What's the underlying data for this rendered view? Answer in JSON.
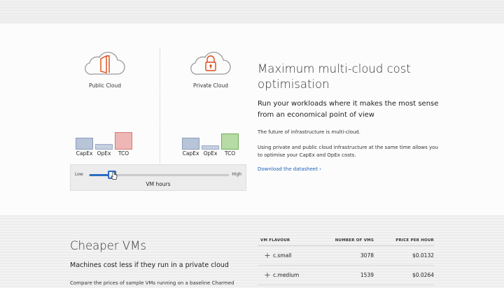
{
  "public_cloud": {
    "label": "Public Cloud",
    "bars": [
      {
        "label": "CapEx",
        "value": 0.62
      },
      {
        "label": "OpEx",
        "value": 0.28
      },
      {
        "label": "TCO",
        "value": 0.9
      }
    ]
  },
  "private_cloud": {
    "label": "Private Cloud",
    "bars": [
      {
        "label": "CapEx",
        "value": 0.6
      },
      {
        "label": "OpEx",
        "value": 0.22
      },
      {
        "label": "TCO",
        "value": 0.82
      }
    ]
  },
  "slider": {
    "low_label": "Low",
    "high_label": "High",
    "caption": "VM hours",
    "value": 0.16
  },
  "section1": {
    "heading": "Maximum multi-cloud cost optimisation",
    "subheading": "Run your workloads where it makes the most sense from an economical point of view",
    "para1": "The future of infrastructure is multi-cloud.",
    "para2": "Using private and public cloud infrastructure at the same time allows you to optimise your CapEx and OpEx costs.",
    "link": "Download the datasheet ›"
  },
  "section2": {
    "heading": "Cheaper VMs",
    "subheading": "Machines cost less if they run in a private cloud",
    "text": "Compare the prices of sample VMs running on a baseline Charmed"
  },
  "vm_table": {
    "headers": [
      "VM FLAVOUR",
      "NUMBER OF VMS",
      "PRICE PER HOUR"
    ],
    "rows": [
      {
        "flavour": "c.small",
        "count": "3078",
        "price": "$0.0132"
      },
      {
        "flavour": "c.medium",
        "count": "1539",
        "price": "$0.0264"
      }
    ]
  },
  "colors": {
    "accent": "#2d6cc0",
    "link": "#2063b8",
    "tco_public": "#eeb7b5",
    "tco_private": "#b6dba5",
    "cloud_icon": "#dd4814"
  }
}
